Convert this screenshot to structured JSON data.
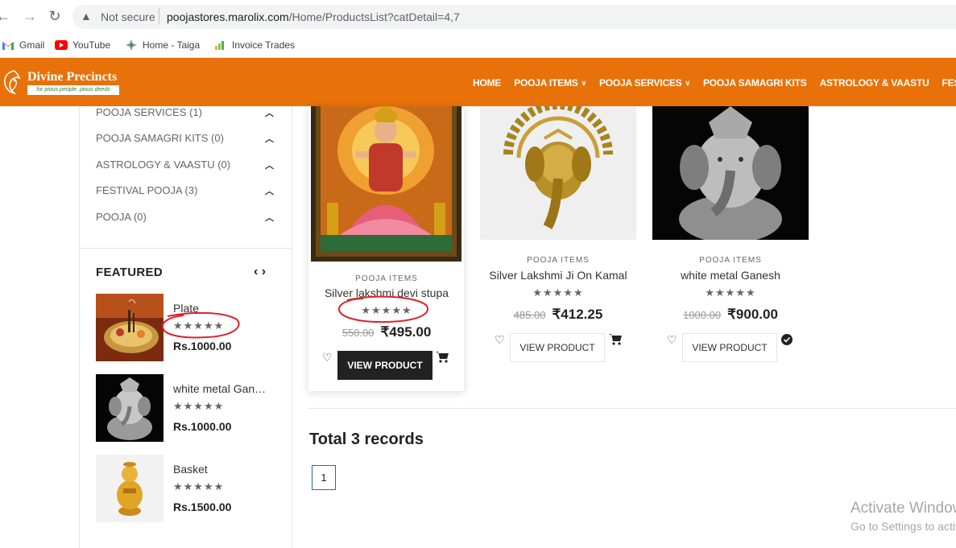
{
  "browser": {
    "not_secure": "Not secure",
    "url_host": "poojastores.marolix.com",
    "url_path": "/Home/ProductsList?catDetail=4,7",
    "bookmarks": [
      {
        "label": "Gmail",
        "icon": "gmail-icon"
      },
      {
        "label": "YouTube",
        "icon": "youtube-icon"
      },
      {
        "label": "Home - Taiga",
        "icon": "taiga-icon"
      },
      {
        "label": "Invoice Trades",
        "icon": "invoice-icon"
      }
    ]
  },
  "header": {
    "brand_title": "Divine Precincts",
    "brand_tagline": "for pious people..pious deeds",
    "menu": [
      {
        "label": "HOME",
        "has_dropdown": false
      },
      {
        "label": "POOJA ITEMS",
        "has_dropdown": true
      },
      {
        "label": "POOJA SERVICES",
        "has_dropdown": true
      },
      {
        "label": "POOJA SAMAGRI KITS",
        "has_dropdown": false
      },
      {
        "label": "ASTROLOGY & VAASTU",
        "has_dropdown": false
      },
      {
        "label": "FESTIV",
        "has_dropdown": false
      }
    ],
    "color": "#e8710a"
  },
  "sidebar": {
    "categories": [
      {
        "label": "POOJA SERVICES (1)"
      },
      {
        "label": "POOJA SAMAGRI KITS (0)"
      },
      {
        "label": "ASTROLOGY & VAASTU (0)"
      },
      {
        "label": "FESTIVAL POOJA (3)"
      },
      {
        "label": "POOJA (0)"
      }
    ],
    "featured_title": "FEATURED",
    "featured": [
      {
        "name": "Plate",
        "stars": "★★★★★",
        "price": "Rs.1000.00"
      },
      {
        "name": "white metal Ganesh",
        "stars": "★★★★★",
        "price": "Rs.1000.00"
      },
      {
        "name": "Basket",
        "stars": "★★★★★",
        "price": "Rs.1500.00"
      }
    ]
  },
  "products": [
    {
      "category": "POOJA ITEMS",
      "name": "Silver lakshmi devi stupa",
      "stars": "★★★★★",
      "old_price": "550.00",
      "price": "₹495.00",
      "button": "VIEW PRODUCT"
    },
    {
      "category": "POOJA ITEMS",
      "name": "Silver Lakshmi Ji On Kamal",
      "stars": "★★★★★",
      "old_price": "485.00",
      "price": "₹412.25",
      "button": "VIEW PRODUCT"
    },
    {
      "category": "POOJA ITEMS",
      "name": "white metal Ganesh",
      "stars": "★★★★★",
      "old_price": "1000.00",
      "price": "₹900.00",
      "button": "VIEW PRODUCT"
    }
  ],
  "listing": {
    "total": "Total 3 records",
    "current_page": "1"
  },
  "watermark": {
    "line1": "Activate Windows",
    "line2": "Go to Settings to activate Windows."
  },
  "colors": {
    "annotation_red": "#e0202a",
    "brand_orange": "#e8710a"
  }
}
